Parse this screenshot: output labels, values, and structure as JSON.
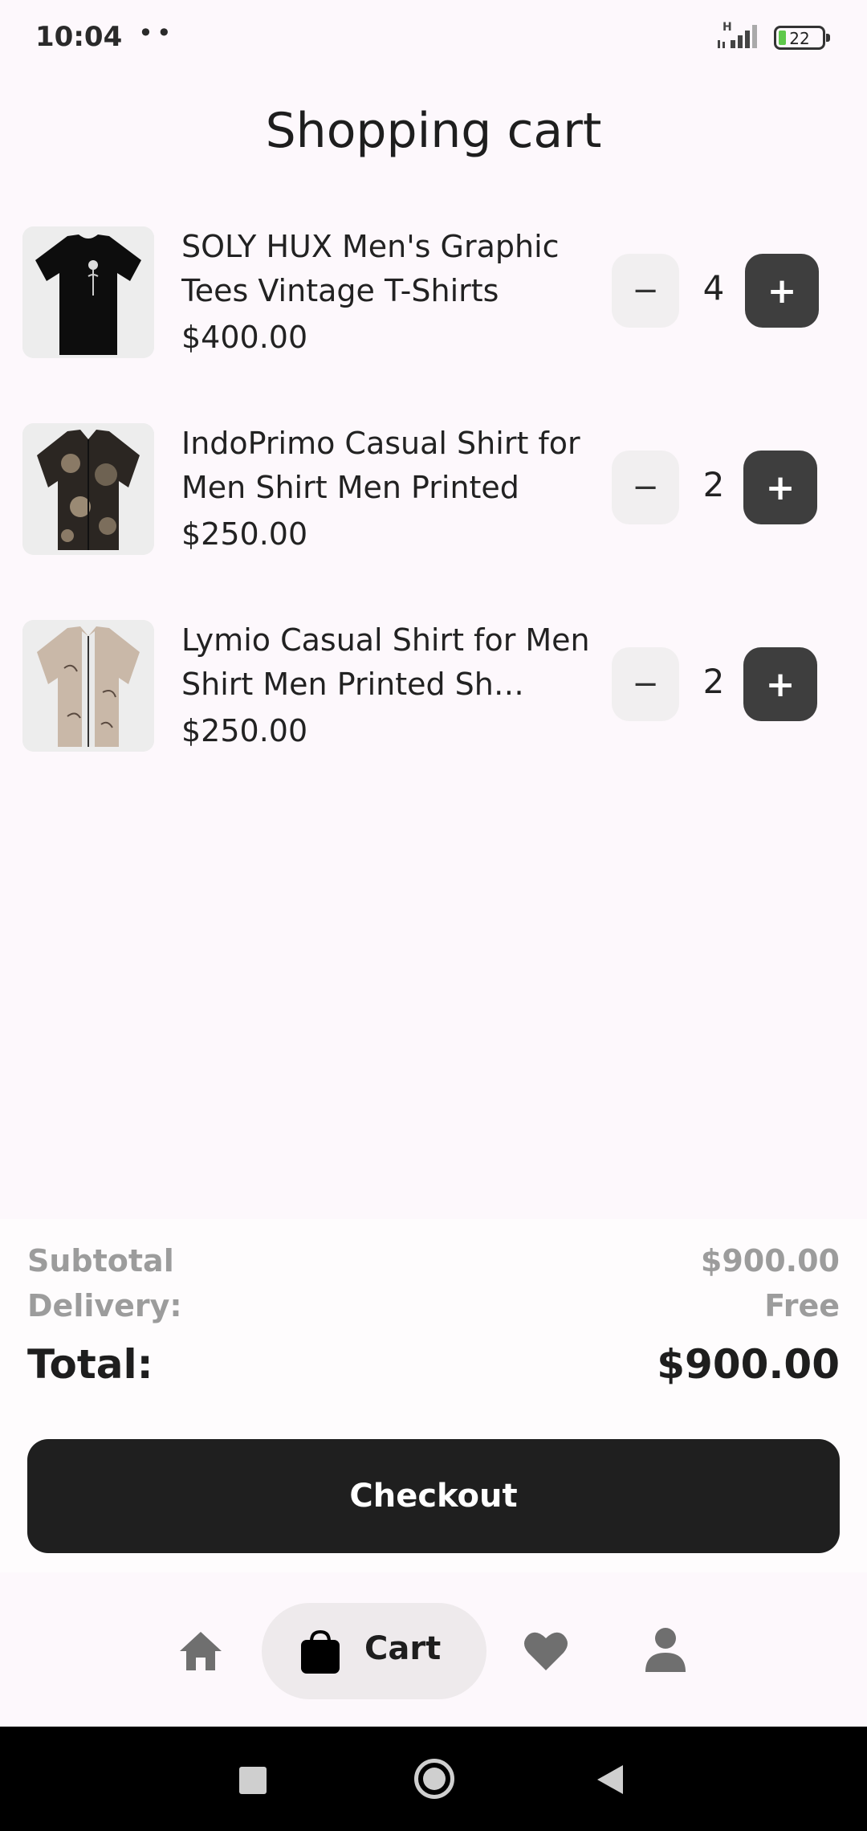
{
  "status_bar": {
    "time": "10:04",
    "dots": "••",
    "network": "H",
    "battery": "22"
  },
  "page": {
    "title": "Shopping cart"
  },
  "cart": {
    "items": [
      {
        "name": "SOLY HUX Men's Graphic Tees Vintage T-Shirts",
        "price": "$400.00",
        "quantity": "4",
        "image": "black-tshirt"
      },
      {
        "name": "IndoPrimo Casual Shirt for Men Shirt Men Printed",
        "price": "$250.00",
        "quantity": "2",
        "image": "dark-printed-shirt"
      },
      {
        "name": "Lymio Casual Shirt for Men Shirt Men Printed Sh…",
        "price": "$250.00",
        "quantity": "2",
        "image": "beige-printed-shirt"
      }
    ],
    "minus_label": "−",
    "plus_label": "+"
  },
  "summary": {
    "subtotal_label": "Subtotal",
    "subtotal_value": "$900.00",
    "delivery_label": "Delivery:",
    "delivery_value": "Free",
    "total_label": "Total:",
    "total_value": "$900.00"
  },
  "checkout": {
    "label": "Checkout"
  },
  "bottom_nav": {
    "items": [
      {
        "icon": "home-icon"
      },
      {
        "icon": "shopping-bag-icon",
        "label": "Cart",
        "active": true
      },
      {
        "icon": "heart-icon"
      },
      {
        "icon": "person-icon"
      }
    ]
  },
  "colors": {
    "background": "#fdf8fc",
    "primary_dark": "#1f1f1f",
    "plus_button": "#3e3e3e",
    "muted_text": "#9c9c9c",
    "battery_green": "#5ec84a"
  }
}
